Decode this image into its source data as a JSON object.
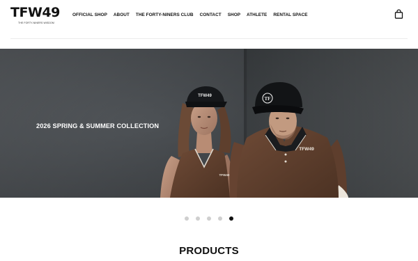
{
  "brand": {
    "logo_text": "TFW49",
    "logo_subtext": "THE FORTY-NINERS WISDOM"
  },
  "nav": {
    "items": [
      {
        "label": "OFFICIAL SHOP"
      },
      {
        "label": "ABOUT"
      },
      {
        "label": "THE FORTY-NINERS CLUB"
      },
      {
        "label": "CONTACT"
      },
      {
        "label": "SHOP"
      },
      {
        "label": "ATHLETE"
      },
      {
        "label": "RENTAL SPACE"
      }
    ],
    "cart_icon": "shopping-bag-icon"
  },
  "hero": {
    "caption": "2026 SPRING & SUMMER COLLECTION",
    "cap_logo_left": "TFW49",
    "cap_logo_right": "TF",
    "shirt_logo": "TFW49",
    "polo_logo": "TFW49"
  },
  "carousel": {
    "slide_count": 5,
    "active_index": 4
  },
  "sections": {
    "products_title": "PRODUCTS"
  },
  "colors": {
    "background": "#ffffff",
    "text": "#111111",
    "dot_inactive": "#cfcfcf",
    "dot_active": "#111111"
  }
}
